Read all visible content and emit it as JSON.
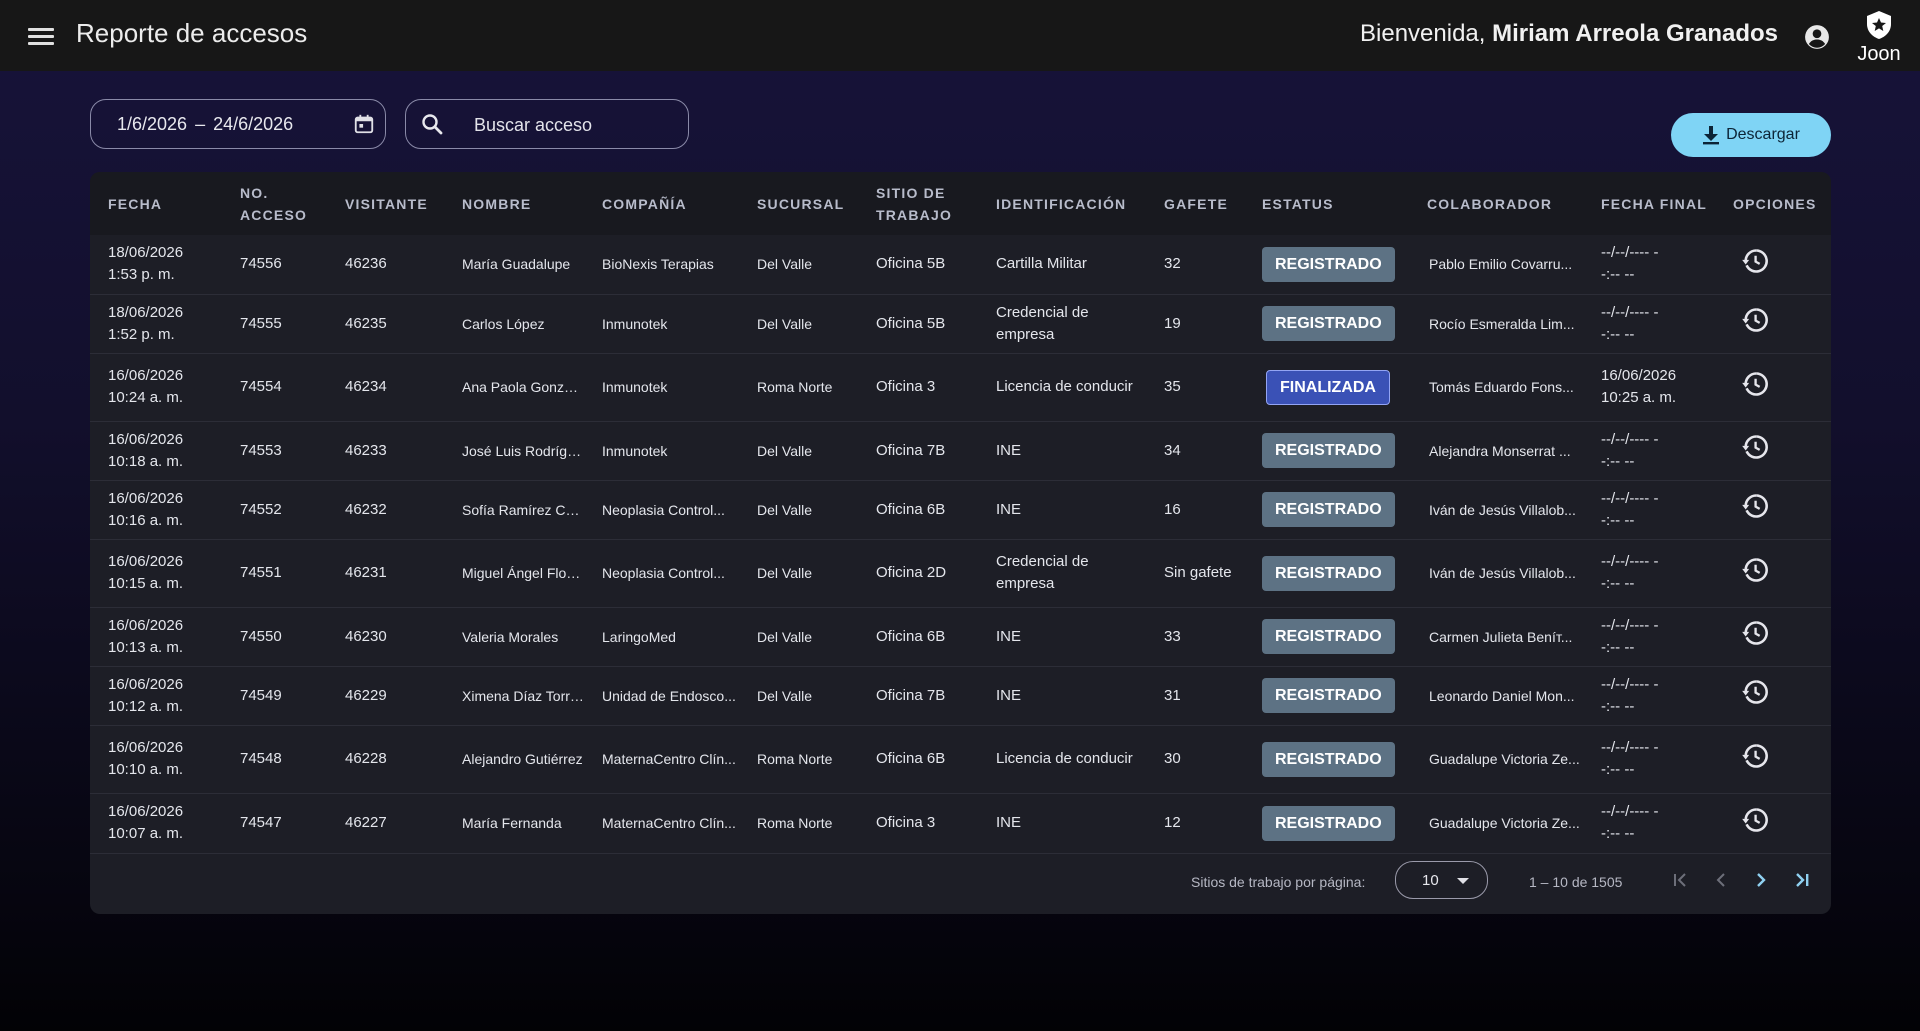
{
  "header": {
    "title": "Reporte de accesos",
    "welcome_prefix": "Bienvenida,",
    "user_name": "Miriam Arreola Granados",
    "logo_text": "Joon"
  },
  "filters": {
    "date_start": "1/6/2026",
    "date_sep": "–",
    "date_end": "24/6/2026",
    "search_placeholder": "Buscar acceso",
    "download_label": "Descargar"
  },
  "table": {
    "columns": [
      "FECHA",
      "NO. ACCESO",
      "VISITANTE",
      "NOMBRE",
      "COMPAÑÍA",
      "SUCURSAL",
      "SITIO DE TRABAJO",
      "IDENTIFICACIÓN",
      "GAFETE",
      "ESTATUS",
      "COLABORADOR",
      "FECHA FINAL",
      "OPCIONES"
    ],
    "rows": [
      {
        "fecha": "18/06/2026",
        "hora": "1:53 p. m.",
        "acceso": "74556",
        "visitante": "46236",
        "nombre": "María Guadalupe",
        "compania": "BioNexis Terapias",
        "sucursal": "Del Valle",
        "sitio": "Oficina 5B",
        "identificacion": "Cartilla Militar",
        "gafete": "32",
        "estatus": "REGISTRADO",
        "colaborador": "Pablo Emilio Covarru...",
        "fecha_final": "--/--/---- -",
        "hora_final": "-:-- --"
      },
      {
        "fecha": "18/06/2026",
        "hora": "1:52 p. m.",
        "acceso": "74555",
        "visitante": "46235",
        "nombre": "Carlos López",
        "compania": "Inmunotek",
        "sucursal": "Del Valle",
        "sitio": "Oficina 5B",
        "identificacion": "Credencial de empresa",
        "gafete": "19",
        "estatus": "REGISTRADO",
        "colaborador": "Rocío Esmeralda Lim...",
        "fecha_final": "--/--/---- -",
        "hora_final": "-:-- --"
      },
      {
        "fecha": "16/06/2026",
        "hora": "10:24 a. m.",
        "acceso": "74554",
        "visitante": "46234",
        "nombre": "Ana Paola González",
        "compania": "Inmunotek",
        "sucursal": "Roma Norte",
        "sitio": "Oficina 3",
        "identificacion": "Licencia de conducir",
        "gafete": "35",
        "estatus": "FINALIZADA",
        "colaborador": "Tomás Eduardo Fons...",
        "fecha_final": "16/06/2026",
        "hora_final": "10:25 a. m."
      },
      {
        "fecha": "16/06/2026",
        "hora": "10:18 a. m.",
        "acceso": "74553",
        "visitante": "46233",
        "nombre": "José Luis Rodríguez",
        "compania": "Inmunotek",
        "sucursal": "Del Valle",
        "sitio": "Oficina 7B",
        "identificacion": "INE",
        "gafete": "34",
        "estatus": "REGISTRADO",
        "colaborador": "Alejandra Monserrat ...",
        "fecha_final": "--/--/---- -",
        "hora_final": "-:-- --"
      },
      {
        "fecha": "16/06/2026",
        "hora": "10:16 a. m.",
        "acceso": "74552",
        "visitante": "46232",
        "nombre": "Sofía Ramírez Cruz",
        "compania": "Neoplasia Control...",
        "sucursal": "Del Valle",
        "sitio": "Oficina 6B",
        "identificacion": "INE",
        "gafete": "16",
        "estatus": "REGISTRADO",
        "colaborador": "Iván de Jesús Villalob...",
        "fecha_final": "--/--/---- -",
        "hora_final": "-:-- --"
      },
      {
        "fecha": "16/06/2026",
        "hora": "10:15 a. m.",
        "acceso": "74551",
        "visitante": "46231",
        "nombre": "Miguel Ángel Flores",
        "compania": "Neoplasia Control...",
        "sucursal": "Del Valle",
        "sitio": "Oficina 2D",
        "identificacion": "Credencial de empresa",
        "gafete": "Sin gafete",
        "estatus": "REGISTRADO",
        "colaborador": "Iván de Jesús Villalob...",
        "fecha_final": "--/--/---- -",
        "hora_final": "-:-- --"
      },
      {
        "fecha": "16/06/2026",
        "hora": "10:13 a. m.",
        "acceso": "74550",
        "visitante": "46230",
        "nombre": "Valeria Morales",
        "compania": "LaringoMed",
        "sucursal": "Del Valle",
        "sitio": "Oficina 6B",
        "identificacion": "INE",
        "gafete": "33",
        "estatus": "REGISTRADO",
        "colaborador": "Carmen Julieta Beníт...",
        "fecha_final": "--/--/---- -",
        "hora_final": "-:-- --"
      },
      {
        "fecha": "16/06/2026",
        "hora": "10:12 a. m.",
        "acceso": "74549",
        "visitante": "46229",
        "nombre": "Ximena Díaz Torres",
        "compania": "Unidad de Endosco...",
        "sucursal": "Del Valle",
        "sitio": "Oficina 7B",
        "identificacion": "INE",
        "gafete": "31",
        "estatus": "REGISTRADO",
        "colaborador": "Leonardo Daniel Mon...",
        "fecha_final": "--/--/---- -",
        "hora_final": "-:-- --"
      },
      {
        "fecha": "16/06/2026",
        "hora": "10:10 a. m.",
        "acceso": "74548",
        "visitante": "46228",
        "nombre": "Alejandro Gutiérrez",
        "compania": "MaternaCentro Clín...",
        "sucursal": "Roma Norte",
        "sitio": "Oficina 6B",
        "identificacion": "Licencia de conducir",
        "gafete": "30",
        "estatus": "REGISTRADO",
        "colaborador": "Guadalupe Victoria Ze...",
        "fecha_final": "--/--/---- -",
        "hora_final": "-:-- --"
      },
      {
        "fecha": "16/06/2026",
        "hora": "10:07 a. m.",
        "acceso": "74547",
        "visitante": "46227",
        "nombre": "María Fernanda",
        "compania": "MaternaCentro Clín...",
        "sucursal": "Roma Norte",
        "sitio": "Oficina 3",
        "identificacion": "INE",
        "gafete": "12",
        "estatus": "REGISTRADO",
        "colaborador": "Guadalupe Victoria Ze...",
        "fecha_final": "--/--/---- -",
        "hora_final": "-:-- --"
      }
    ]
  },
  "pagination": {
    "rows_per_page_label": "Sitios de trabajo por página:",
    "rows_per_page": "10",
    "range": "1 – 10 de 1505"
  },
  "colors": {
    "accent": "#7fd4f5",
    "registrado": "#5d7284",
    "finalizada": "#3a51b6"
  },
  "icons": [
    "menu-icon",
    "account-circle-icon",
    "joon-shield-logo",
    "calendar-icon",
    "search-icon",
    "download-icon",
    "history-icon",
    "first-page-icon",
    "chevron-left-icon",
    "chevron-right-icon",
    "last-page-icon"
  ]
}
